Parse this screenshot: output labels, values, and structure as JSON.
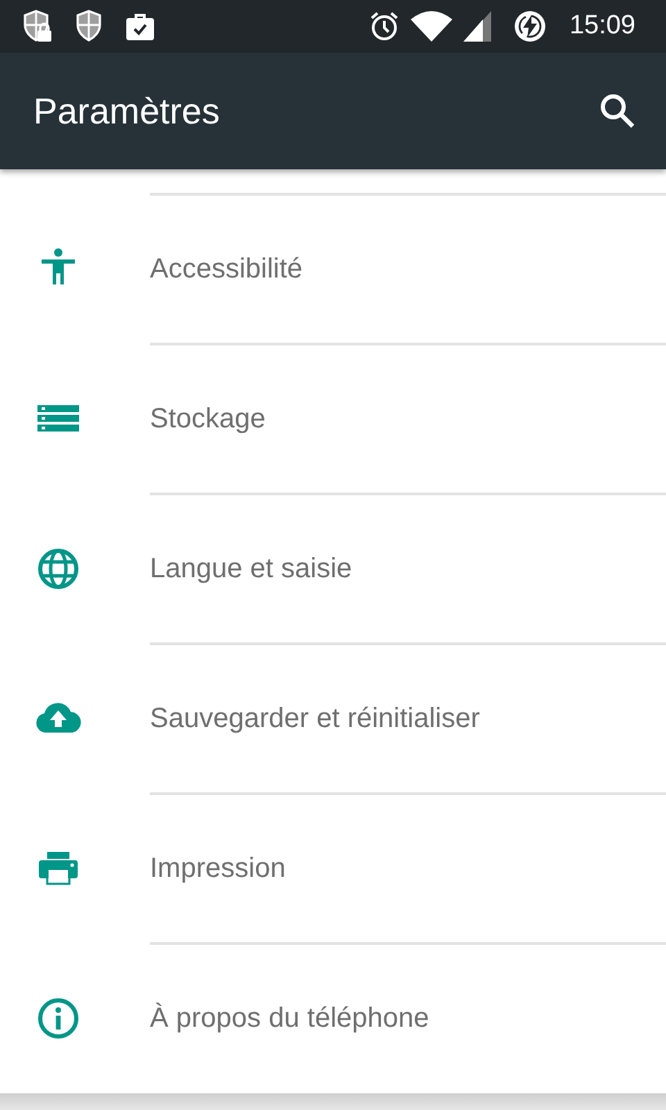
{
  "status_bar": {
    "time": "15:09"
  },
  "app_bar": {
    "title": "Paramètres"
  },
  "settings": [
    {
      "label": "Accessibilité"
    },
    {
      "label": "Stockage"
    },
    {
      "label": "Langue et saisie"
    },
    {
      "label": "Sauvegarder et réinitialiser"
    },
    {
      "label": "Impression"
    },
    {
      "label": "À propos du téléphone"
    }
  ]
}
